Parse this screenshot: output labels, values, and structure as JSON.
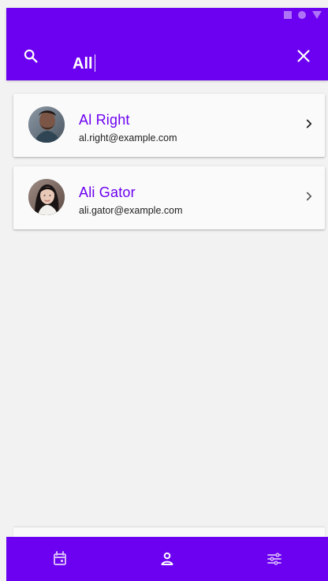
{
  "top_bar": {
    "search_text": "All",
    "search_icon": "search-icon",
    "clear_icon": "close-icon",
    "status_icons": [
      "square-icon",
      "circle-icon",
      "triangle-icon"
    ]
  },
  "contacts": [
    {
      "name": "Al Right",
      "email": "al.right@example.com",
      "avatar_icon": "avatar",
      "chevron_icon": "chevron-right-icon"
    },
    {
      "name": "Ali Gator",
      "email": "ali.gator@example.com",
      "avatar_icon": "avatar",
      "chevron_icon": "chevron-right-icon"
    }
  ],
  "bottom_nav": {
    "items": [
      {
        "icon": "calendar-icon",
        "selected": false
      },
      {
        "icon": "person-icon",
        "selected": true
      },
      {
        "icon": "tune-icon",
        "selected": false
      }
    ]
  },
  "colors": {
    "accent": "#6c00f0",
    "background": "#f2f2f2",
    "card": "#fafafa",
    "text_primary": "#222222",
    "icon_white": "#ffffff"
  }
}
